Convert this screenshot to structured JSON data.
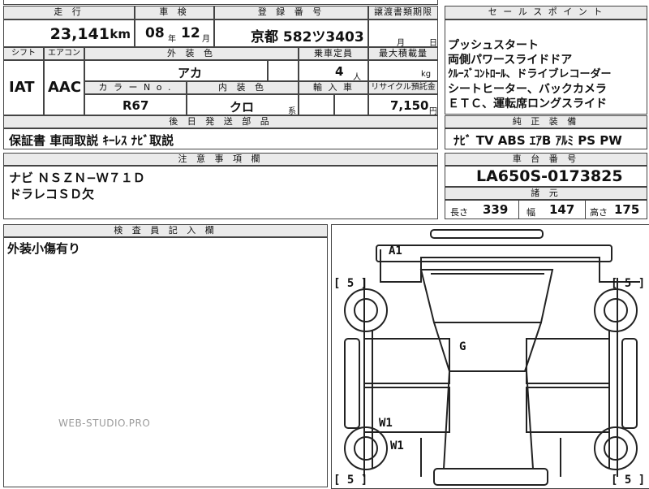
{
  "headers": {
    "mileage": "走 行",
    "inspection": "車 検",
    "registration": "登 録 番 号",
    "transfer_deadline": "譲渡書類期限",
    "sales_point": "セ ー ル ス ポ イ ン ト",
    "shift": "シフト",
    "aircon": "エアコン",
    "exterior_color": "外 装 色",
    "capacity": "乗車定員",
    "max_load": "最大積載量",
    "color_no": "カ ラ ー N o .",
    "interior_color": "内 装 色",
    "import": "輸 入 車",
    "recycle": "リサイクル預託金",
    "accessories": "後 日 発 送 部 品",
    "genuine_equipment": "純 正 装 備",
    "notes": "注 意 事 項 欄",
    "chassis_no": "車 台 番 号",
    "specs": "諸 元",
    "inspector_notes": "検 査 員 記 入 欄"
  },
  "vehicle": {
    "mileage_value": "23,141",
    "mileage_unit": "km",
    "inspection_year": "08",
    "year_unit": "年",
    "inspection_month": "12",
    "month_unit": "月",
    "registration": "京都 582ツ3403",
    "transfer_month_unit": "月",
    "transfer_day_unit": "日",
    "shift": "IAT",
    "aircon": "AAC",
    "exterior_color": "アカ",
    "capacity": "4",
    "capacity_unit": "人",
    "max_load_unit": "kg",
    "color_no": "R67",
    "interior_color": "クロ",
    "interior_suffix": "系",
    "recycle_value": "7,150",
    "recycle_unit": "円"
  },
  "sales_points": [
    "プッシュスタート",
    "両側パワースライドドア",
    "ｸﾙｰｽﾞｺﾝﾄﾛｰﾙ、ドライブレコーダー",
    "シートヒーター、バックカメラ",
    "ＥＴＣ、運転席ロングスライド"
  ],
  "accessories_text": "保証書 車両取説 ｷｰﾚｽ ﾅﾋﾞ取説",
  "genuine_equipment_text": "ﾅﾋﾞ TV ABS ｴｱB ｱﾙﾐ PS PW",
  "notes_lines": [
    "ナビ ＮＳＺＮ−Ｗ７１Ｄ",
    "ドラレコＳＤ欠"
  ],
  "chassis_no": "LA650S-0173825",
  "specs": {
    "length_label": "長さ",
    "length_value": "339",
    "width_label": "幅",
    "width_value": "147",
    "height_label": "高さ",
    "height_value": "175"
  },
  "inspector_text": "外装小傷有り",
  "diagram_marks": {
    "a1": "A1",
    "g": "G",
    "w1_top": "W1",
    "w1_bottom": "W1",
    "tire_fl": "[ 5 ]",
    "tire_fr": "[ 5 ]",
    "tire_rl": "[ 5 ]",
    "tire_rr": "[ 5 ]"
  },
  "watermark": "WEB-STUDIO.PRO"
}
